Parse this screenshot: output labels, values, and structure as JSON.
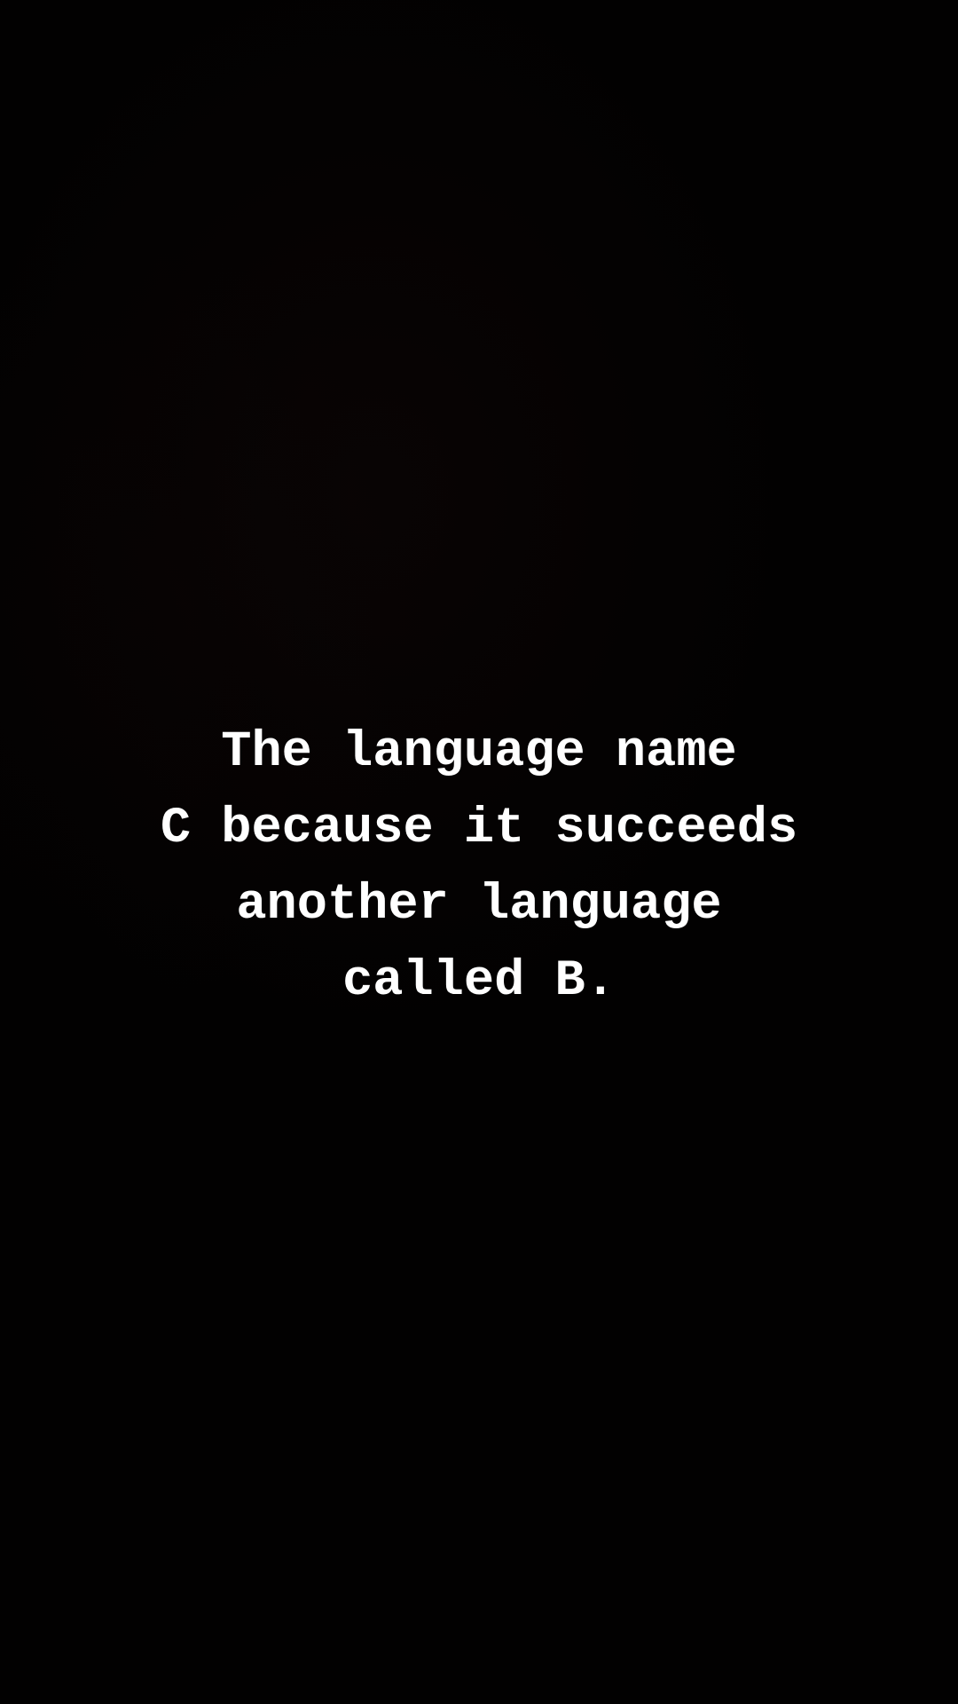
{
  "background_color": "#000000",
  "text_color": "#ffffff",
  "caption": {
    "lines": [
      "The language name",
      "C because it succeeds",
      "another language",
      "called B."
    ]
  }
}
